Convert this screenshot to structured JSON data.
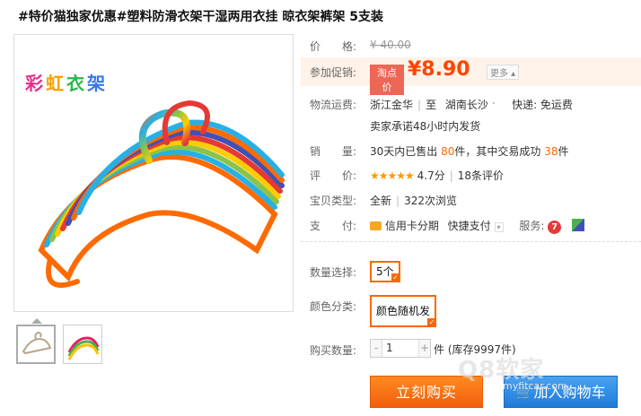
{
  "product": {
    "title": "#特价猫独家优惠#塑料防滑衣架干湿两用衣挂 晾衣架裤架 5支装",
    "logo_chars": [
      "彩",
      "虹",
      "衣",
      "架"
    ]
  },
  "price": {
    "label": "价　　格:",
    "original": "¥ 40.00"
  },
  "promo": {
    "label": "参加促销:",
    "tag": "淘点价",
    "price": "¥8.90",
    "more": "更多 ▴"
  },
  "shipping": {
    "label": "物流运费:",
    "from": "浙江金华",
    "to_prefix": "至",
    "to": "湖南长沙",
    "express": "快递: 免运费",
    "note": "卖家承诺48小时内发货"
  },
  "sales": {
    "label": "销　　量:",
    "prefix": "30天内已售出",
    "sold": "80",
    "mid": "件，其中交易成功",
    "success": "38",
    "suffix": "件"
  },
  "rating": {
    "label": "评　　价:",
    "stars": "★★★★★",
    "score": "4.7分",
    "count": "18条评价"
  },
  "type": {
    "label": "宝贝类型:",
    "condition": "全新",
    "views": "322次浏览"
  },
  "payment": {
    "label": "支　　付:",
    "installment": "信用卡分期",
    "fast_pay": "快捷支付",
    "service_label": "服务:",
    "service_badge": "7"
  },
  "options": {
    "quantity_label": "数量选择:",
    "quantity_value": "5个",
    "color_label": "颜色分类:",
    "color_value": "颜色随机发"
  },
  "purchase": {
    "label": "购买数量:",
    "minus": "-",
    "qty": "1",
    "plus": "+",
    "stock": "件 (库存9997件)",
    "buy_now": "立刻购买",
    "add_cart": "加入购物车"
  },
  "colors": {
    "accent": "#ff6600",
    "price": "#ff4400",
    "cart_blue": "#1f7bd8"
  },
  "watermark": {
    "text": "Q8软家",
    "sub": "myfitcar.com"
  }
}
